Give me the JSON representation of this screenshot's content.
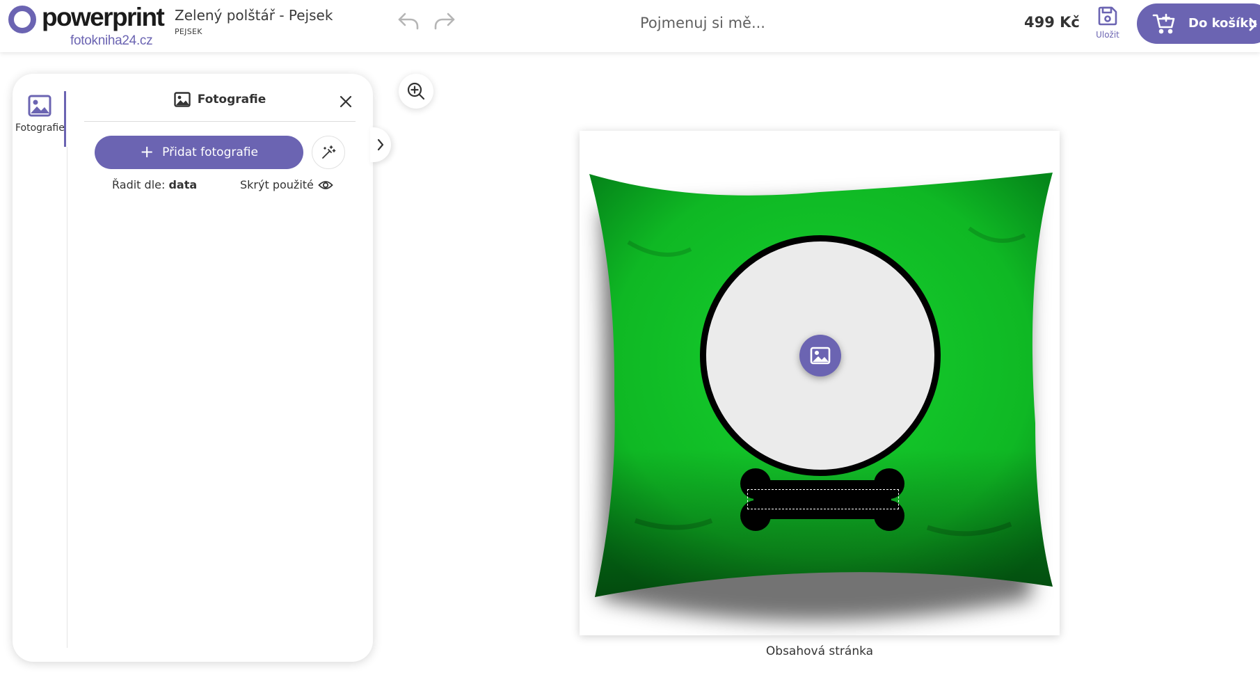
{
  "brand": {
    "name": "powerprint",
    "sub": "fotokniha24.cz",
    "accent": "#6b64b2"
  },
  "header": {
    "product_title": "Zelený polštář - Pejsek",
    "product_sub": "PEJSEK",
    "name_placeholder": "Pojmenuj si mě...",
    "price": "499 Kč",
    "save_label": "Uložit",
    "cart_label": "Do košíku"
  },
  "sidebar": {
    "tab_label": "Fotografie"
  },
  "panel": {
    "title": "Fotografie",
    "add_photos_label": "Přidat fotografie",
    "sort_prefix": "Řadit dle:",
    "sort_value": "data",
    "hide_used_label": "Skrýt použité"
  },
  "canvas": {
    "page_label": "Obsahová stránka",
    "pillow_color": "#12c428",
    "frame_color": "#000000"
  },
  "icons": [
    "undo-icon",
    "redo-icon",
    "save-icon",
    "cart-icon",
    "chevron-right-icon",
    "image-icon",
    "close-icon",
    "plus-icon",
    "magic-wand-icon",
    "eye-icon",
    "zoom-in-icon"
  ]
}
